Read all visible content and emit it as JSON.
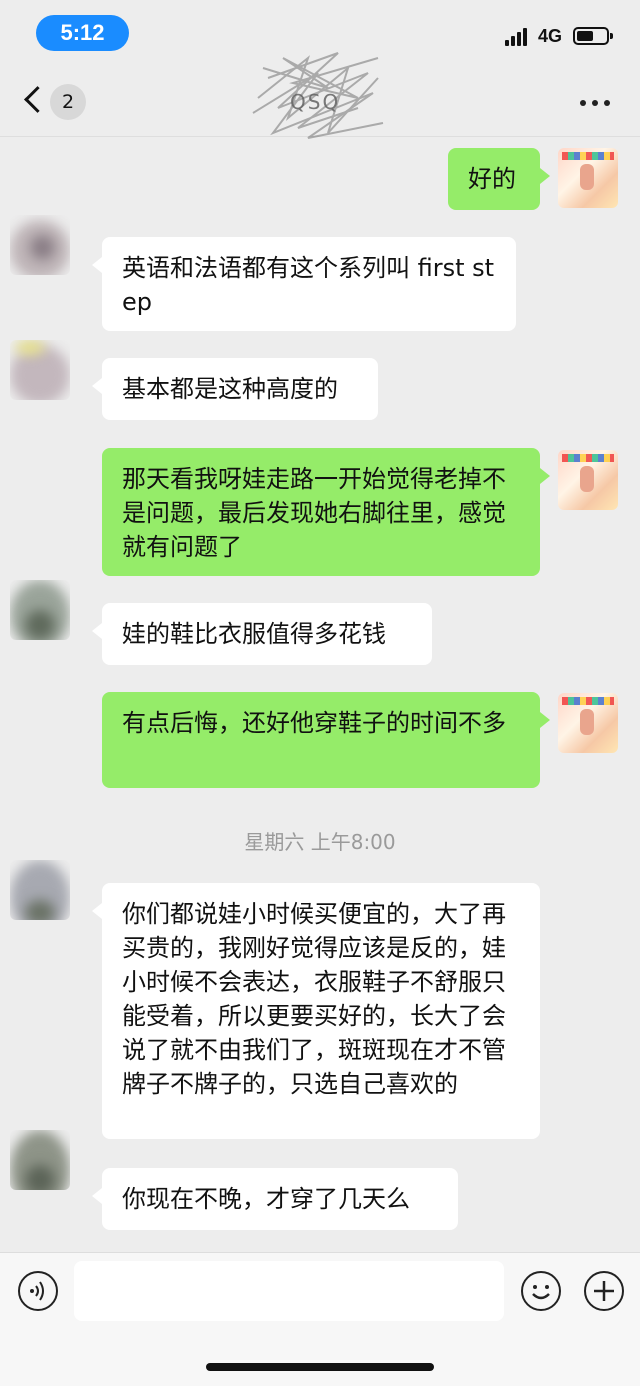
{
  "status": {
    "time": "5:12",
    "network": "4G"
  },
  "nav": {
    "unread_count": "2",
    "title": "QSQ"
  },
  "messages": [
    {
      "side": "right",
      "text": "好的"
    },
    {
      "side": "left",
      "text": "英语和法语都有这个系列叫 first step"
    },
    {
      "side": "left",
      "text": "基本都是这种高度的"
    },
    {
      "side": "right",
      "text": "那天看我呀娃走路一开始觉得老掉不是问题，最后发现她右脚往里，感觉就有问题了"
    },
    {
      "side": "left",
      "text": "娃的鞋比衣服值得多花钱"
    },
    {
      "side": "right",
      "text": "有点后悔，还好他穿鞋子的时间不多"
    },
    {
      "side": "left",
      "text": "你们都说娃小时候买便宜的，大了再买贵的，我刚好觉得应该是反的，娃小时候不会表达，衣服鞋子不舒服只能受着，所以更要买好的，长大了会说了就不由我们了，斑斑现在才不管牌子不牌子的，只选自己喜欢的"
    },
    {
      "side": "left",
      "text": "你现在不晚，才穿了几天么"
    }
  ],
  "timestamp": "星期六 上午8:00",
  "input": {
    "placeholder": ""
  },
  "icons": [
    "back-chevron-icon",
    "more-dots-icon",
    "voice-icon",
    "emoji-icon",
    "plus-icon"
  ],
  "colors": {
    "my_bubble": "#95ec69",
    "their_bubble": "#ffffff",
    "background": "#ededed",
    "time_pill": "#1a8cff"
  }
}
